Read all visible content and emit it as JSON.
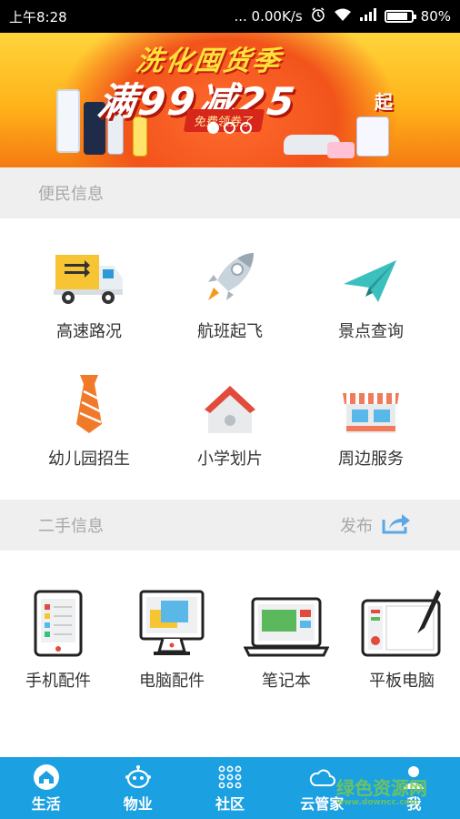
{
  "status_bar": {
    "time": "上午8:28",
    "network_speed": "... 0.00K/s",
    "battery": "80%",
    "battery_level": 0.8
  },
  "banner": {
    "headline": "洗化囤货季",
    "offer": "满99减25",
    "offer_suffix": "起",
    "coupon": "免费领券了",
    "slides": 3,
    "active_slide": 1
  },
  "convenience": {
    "title": "便民信息",
    "items": [
      {
        "label": "高速路况",
        "icon": "truck-icon"
      },
      {
        "label": "航班起飞",
        "icon": "rocket-icon"
      },
      {
        "label": "景点查询",
        "icon": "paper-plane-icon"
      },
      {
        "label": "幼儿园招生",
        "icon": "necktie-icon"
      },
      {
        "label": "小学划片",
        "icon": "house-icon"
      },
      {
        "label": "周边服务",
        "icon": "storefront-icon"
      }
    ]
  },
  "secondhand": {
    "title": "二手信息",
    "publish_label": "发布",
    "items": [
      {
        "label": "手机配件",
        "icon": "phone-icon"
      },
      {
        "label": "电脑配件",
        "icon": "monitor-icon"
      },
      {
        "label": "笔记本",
        "icon": "laptop-icon"
      },
      {
        "label": "平板电脑",
        "icon": "tablet-pen-icon"
      }
    ]
  },
  "tabbar": {
    "items": [
      {
        "label": "生活",
        "icon": "home-icon",
        "active": true
      },
      {
        "label": "物业",
        "icon": "robot-icon",
        "active": false
      },
      {
        "label": "社区",
        "icon": "grid-icon",
        "active": false
      },
      {
        "label": "云管家",
        "icon": "cloud-icon",
        "active": false
      },
      {
        "label": "我",
        "icon": "person-icon",
        "active": false
      }
    ]
  },
  "watermark": {
    "text": "绿色资源网",
    "url": "www.downcc.com"
  },
  "colors": {
    "accent": "#1ba0e2",
    "section_bg": "#efeff0",
    "text": "#333333",
    "muted": "#a7a7a7"
  }
}
